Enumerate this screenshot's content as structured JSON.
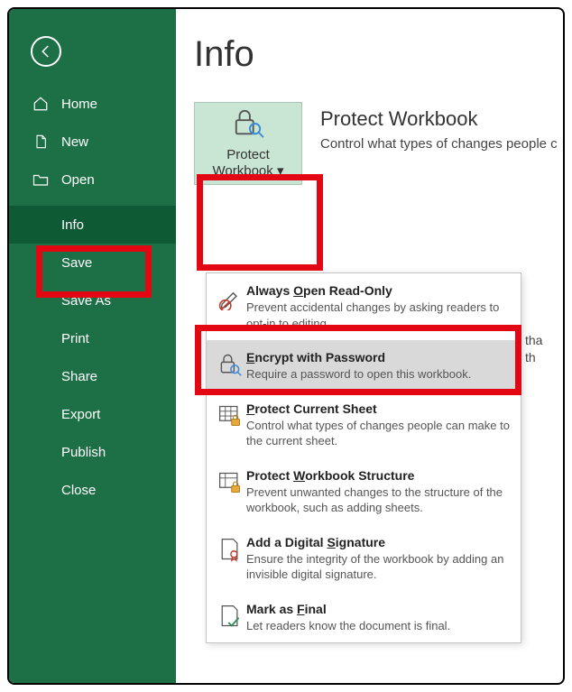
{
  "page": {
    "title": "Info"
  },
  "sidebar": {
    "items": [
      {
        "label": "Home"
      },
      {
        "label": "New"
      },
      {
        "label": "Open"
      },
      {
        "label": "Info"
      },
      {
        "label": "Save"
      },
      {
        "label": "Save As"
      },
      {
        "label": "Print"
      },
      {
        "label": "Share"
      },
      {
        "label": "Export"
      },
      {
        "label": "Publish"
      },
      {
        "label": "Close"
      }
    ]
  },
  "protect": {
    "button_label": "Protect Workbook",
    "heading": "Protect Workbook",
    "description": "Control what types of changes people c"
  },
  "side_text": {
    "line1": "tha",
    "line2": "th"
  },
  "menu": {
    "items": [
      {
        "title_pre": "Always ",
        "title_u": "O",
        "title_post": "pen Read-Only",
        "desc": "Prevent accidental changes by asking readers to opt-in to editing."
      },
      {
        "title_pre": "",
        "title_u": "E",
        "title_post": "ncrypt with Password",
        "desc": "Require a password to open this workbook."
      },
      {
        "title_pre": "",
        "title_u": "P",
        "title_post": "rotect Current Sheet",
        "desc": "Control what types of changes people can make to the current sheet."
      },
      {
        "title_pre": "Protect ",
        "title_u": "W",
        "title_post": "orkbook Structure",
        "desc": "Prevent unwanted changes to the structure of the workbook, such as adding sheets."
      },
      {
        "title_pre": "Add a Digital ",
        "title_u": "S",
        "title_post": "ignature",
        "desc": "Ensure the integrity of the workbook by adding an invisible digital signature."
      },
      {
        "title_pre": "Mark as ",
        "title_u": "F",
        "title_post": "inal",
        "desc": "Let readers know the document is final."
      }
    ]
  }
}
